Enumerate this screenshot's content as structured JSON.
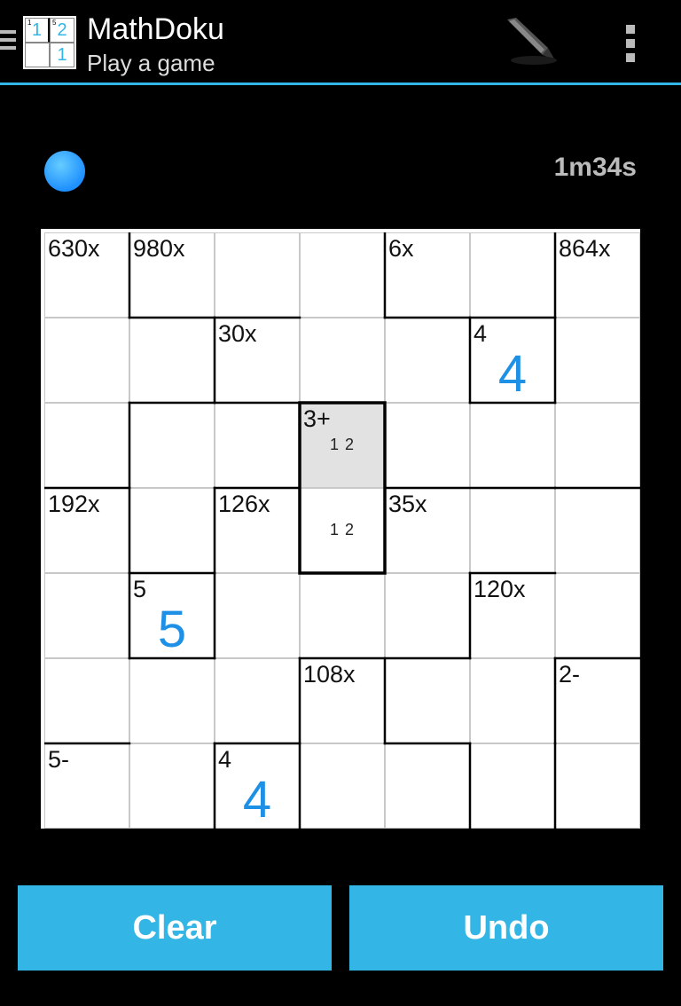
{
  "app": {
    "title": "MathDoku",
    "subtitle": "Play a game",
    "icon_digits": [
      "1",
      "2",
      "",
      "1"
    ],
    "icon_small": [
      "1",
      "5"
    ]
  },
  "status": {
    "timer": "1m34s",
    "indicator_color": "#1e90ff"
  },
  "grid": {
    "size": 7,
    "cells": [
      [
        {
          "cage": "630x"
        },
        {
          "cage": "980x"
        },
        {},
        {},
        {
          "cage": "6x"
        },
        {},
        {
          "cage": "864x"
        }
      ],
      [
        {},
        {},
        {
          "cage": "30x"
        },
        {},
        {},
        {
          "cage": "4",
          "value": "4"
        },
        {}
      ],
      [
        {},
        {},
        {},
        {
          "cage": "3+",
          "possibles": "1 2",
          "selected": true
        },
        {},
        {},
        {}
      ],
      [
        {
          "cage": "192x"
        },
        {},
        {
          "cage": "126x"
        },
        {
          "possibles": "1 2"
        },
        {
          "cage": "35x"
        },
        {},
        {}
      ],
      [
        {},
        {
          "cage": "5",
          "value": "5"
        },
        {},
        {},
        {},
        {
          "cage": "120x"
        },
        {}
      ],
      [
        {},
        {},
        {},
        {
          "cage": "108x"
        },
        {},
        {},
        {
          "cage": "2-"
        }
      ],
      [
        {
          "cage": "5-"
        },
        {},
        {
          "cage": "4",
          "value": "4"
        },
        {},
        {},
        {},
        {}
      ]
    ]
  },
  "buttons": {
    "clear": "Clear",
    "undo": "Undo"
  },
  "colors": {
    "accent": "#33b5e5",
    "value": "#1e90e6",
    "selected_bg": "#e2e2e2"
  }
}
